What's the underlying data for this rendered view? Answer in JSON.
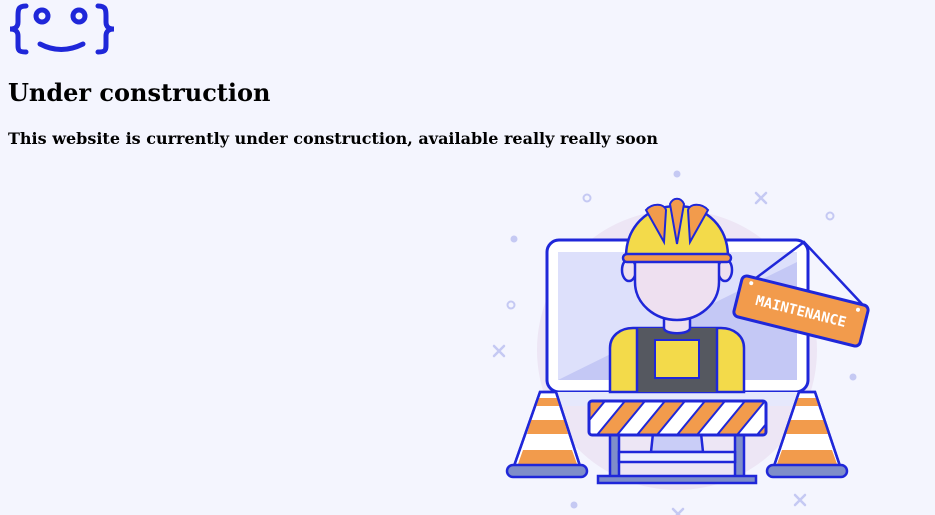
{
  "logo": {
    "icon": "smiley-braces-icon",
    "color": "#1f27d9"
  },
  "page": {
    "title": "Under construction",
    "subtitle": "This website is currently under construction, available really really soon"
  },
  "illustration": {
    "name": "construction-worker-illustration",
    "sign_text": "MAINTENANCE",
    "colors": {
      "outline": "#1f27d9",
      "orange": "#f29b4c",
      "yellow": "#f3da4a",
      "background": "#f4f5fe"
    }
  }
}
